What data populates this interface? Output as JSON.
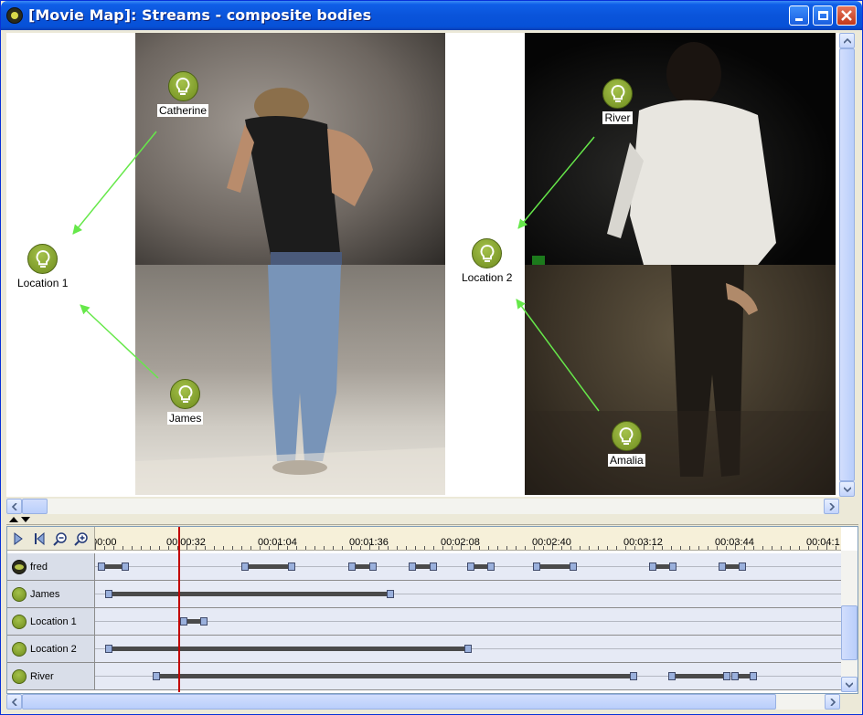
{
  "window": {
    "title": "[Movie Map]: Streams - composite bodies",
    "minimize_icon": "minimize-icon",
    "maximize_icon": "maximize-icon",
    "close_icon": "close-icon"
  },
  "map": {
    "nodes": [
      {
        "id": "catherine",
        "label": "Catherine",
        "icon": "lightbulb-icon"
      },
      {
        "id": "james",
        "label": "James",
        "icon": "lightbulb-icon"
      },
      {
        "id": "location1",
        "label": "Location 1",
        "icon": "lightbulb-icon"
      },
      {
        "id": "location2",
        "label": "Location 2",
        "icon": "lightbulb-icon"
      },
      {
        "id": "river",
        "label": "River",
        "icon": "lightbulb-icon"
      },
      {
        "id": "amalia",
        "label": "Amalia",
        "icon": "lightbulb-icon"
      }
    ],
    "arrow_color": "#66e84a"
  },
  "timeline": {
    "tools": [
      "play-icon",
      "rewind-to-start-icon",
      "zoom-out-icon",
      "zoom-in-icon"
    ],
    "ruler_labels": [
      "00:00",
      "00:00:32",
      "00:01:04",
      "00:01:36",
      "00:02:08",
      "00:02:40",
      "00:03:12",
      "00:03:44",
      "00:04:1"
    ],
    "playhead_color": "#c20000",
    "rows": [
      {
        "label": "fred",
        "icon": "group-icon"
      },
      {
        "label": "James",
        "icon": "lightbulb-icon"
      },
      {
        "label": "Location 1",
        "icon": "lightbulb-icon"
      },
      {
        "label": "Location 2",
        "icon": "lightbulb-icon"
      },
      {
        "label": "River",
        "icon": "lightbulb-icon"
      }
    ]
  }
}
